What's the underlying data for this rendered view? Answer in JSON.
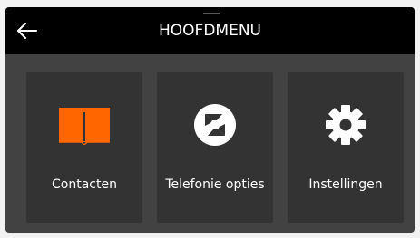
{
  "header": {
    "title": "HOOFDMENU",
    "back_icon": "back-arrow-icon"
  },
  "tiles": [
    {
      "label": "Contacten",
      "icon": "phonebook-icon",
      "icon_color": "#ff6600"
    },
    {
      "label": "Telefonie opties",
      "icon": "telephony-icon",
      "icon_color": "#ffffff"
    },
    {
      "label": "Instellingen",
      "icon": "gear-icon",
      "icon_color": "#ffffff"
    }
  ],
  "colors": {
    "background": "#424242",
    "header": "#000000",
    "tile": "#333333",
    "accent": "#ff6600",
    "text": "#ffffff"
  }
}
